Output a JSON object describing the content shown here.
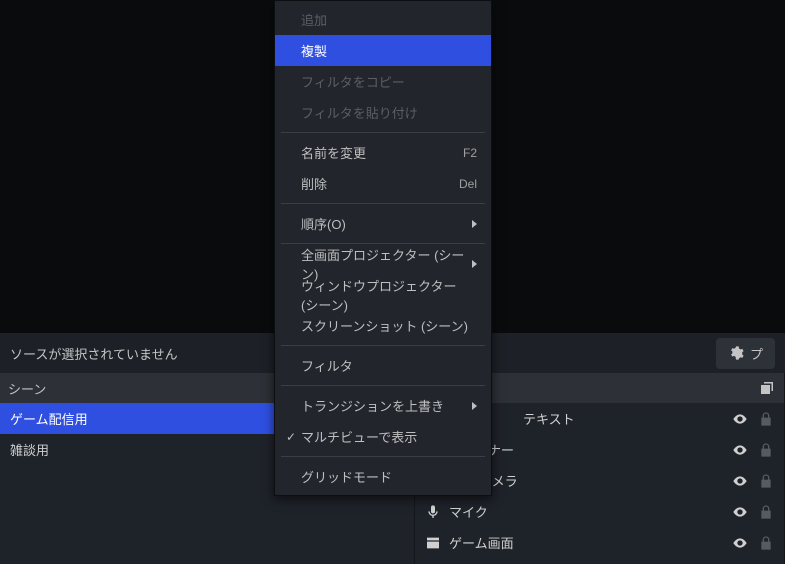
{
  "preview": {},
  "no_source_bar": {
    "message": "ソースが選択されていません",
    "properties_btn_prefix": "プ"
  },
  "panels": {
    "scenes": {
      "title": "シーン",
      "items": [
        {
          "label": "ゲーム配信用",
          "selected": true
        },
        {
          "label": "雑談用",
          "selected": false
        }
      ]
    },
    "sources": {
      "title": "",
      "items": [
        {
          "icon": "text",
          "label": "テキスト"
        },
        {
          "icon": "image",
          "label": "広告バナー"
        },
        {
          "icon": "video",
          "label": "WEBカメラ"
        },
        {
          "icon": "mic",
          "label": "マイク"
        },
        {
          "icon": "window",
          "label": "ゲーム画面"
        }
      ]
    }
  },
  "context_menu": {
    "items": [
      {
        "type": "item",
        "label": "追加",
        "disabled": true
      },
      {
        "type": "item",
        "label": "複製",
        "highlight": true
      },
      {
        "type": "item",
        "label": "フィルタをコピー",
        "disabled": true
      },
      {
        "type": "item",
        "label": "フィルタを貼り付け",
        "disabled": true
      },
      {
        "type": "sep"
      },
      {
        "type": "item",
        "label": "名前を変更",
        "shortcut": "F2"
      },
      {
        "type": "item",
        "label": "削除",
        "shortcut": "Del"
      },
      {
        "type": "sep"
      },
      {
        "type": "item",
        "label": "順序(O)",
        "submenu": true
      },
      {
        "type": "sep"
      },
      {
        "type": "item",
        "label": "全画面プロジェクター (シーン)",
        "submenu": true
      },
      {
        "type": "item",
        "label": "ウィンドウプロジェクター (シーン)"
      },
      {
        "type": "item",
        "label": "スクリーンショット (シーン)"
      },
      {
        "type": "sep"
      },
      {
        "type": "item",
        "label": "フィルタ"
      },
      {
        "type": "sep"
      },
      {
        "type": "item",
        "label": "トランジションを上書き",
        "submenu": true
      },
      {
        "type": "item",
        "label": "マルチビューで表示",
        "checked": true
      },
      {
        "type": "sep"
      },
      {
        "type": "item",
        "label": "グリッドモード"
      }
    ]
  }
}
